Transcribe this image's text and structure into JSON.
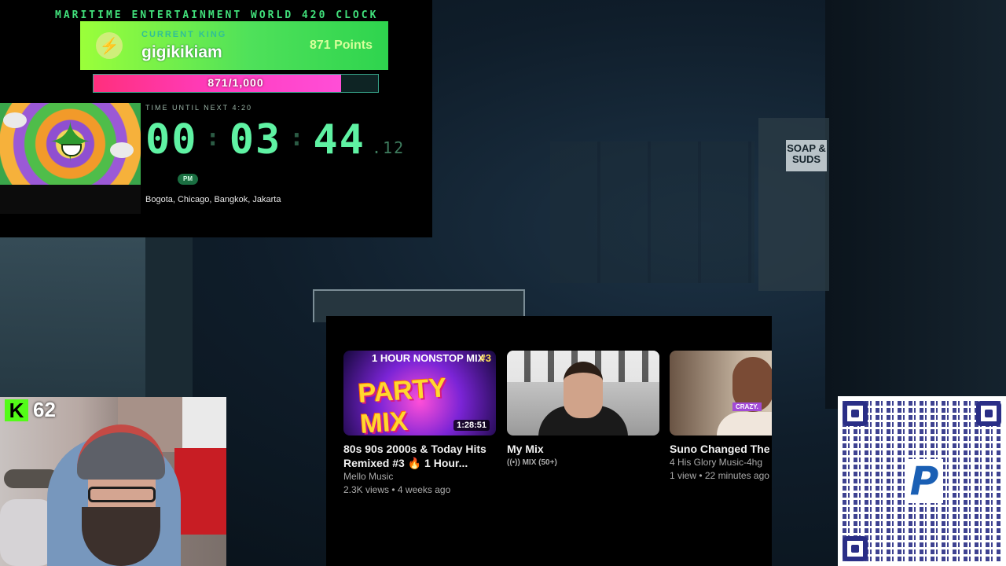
{
  "clock": {
    "title": "MARITIME ENTERTAINMENT WORLD 420 CLOCK",
    "king_label": "CURRENT KING",
    "king_name": "gigikikiam",
    "king_points": "871 Points",
    "progress_text": "871/1,000",
    "progress_fraction": 0.871,
    "time_label": "TIME UNTIL NEXT 4:20",
    "hours": "00",
    "minutes": "03",
    "seconds": "44",
    "hundredths": ".12",
    "ampm": "PM",
    "cities": "Bogota, Chicago, Bangkok, Jakarta"
  },
  "kick": {
    "logo_text": "K",
    "viewer_count": "62"
  },
  "youtube": {
    "videos": [
      {
        "thumb_top": "1 HOUR NONSTOP MIX",
        "thumb_num": "#3",
        "thumb_main": "PARTY MIX",
        "duration": "1:28:51",
        "title": "80s 90s 2000s & Today Hits Remixed #3 🔥 1 Hour...",
        "channel": "Mello Music",
        "meta": "2.3K views • 4 weeks ago"
      },
      {
        "title": "My Mix",
        "badge": "((•)) MIX (50+)"
      },
      {
        "thumb_tag": "CRAZY.",
        "title": "Suno Changed The G",
        "channel": "4 His Glory Music-4hg",
        "meta": "1 view • 22 minutes ago"
      }
    ]
  },
  "background": {
    "sign_text": "SOAP & SUDS"
  },
  "qr": {
    "logo_text": "P"
  }
}
